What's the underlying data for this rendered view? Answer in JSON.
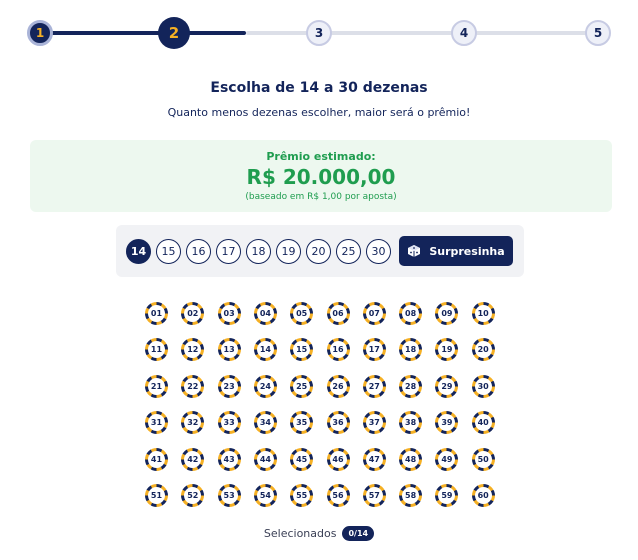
{
  "stepper": {
    "steps": [
      {
        "label": "1",
        "state": "done"
      },
      {
        "label": "2",
        "state": "current"
      },
      {
        "label": "3",
        "state": "todo"
      },
      {
        "label": "4",
        "state": "todo"
      },
      {
        "label": "5",
        "state": "todo"
      }
    ]
  },
  "header": {
    "title": "Escolha de 14 a 30 dezenas",
    "subtitle": "Quanto menos dezenas escolher, maior será o prêmio!"
  },
  "prize": {
    "label": "Prêmio estimado:",
    "value": "R$ 20.000,00",
    "note": "(baseado em R$ 1,00 por aposta)"
  },
  "picker": {
    "options": [
      "14",
      "15",
      "16",
      "17",
      "18",
      "19",
      "20",
      "25",
      "30"
    ],
    "selected": "14",
    "surprise_label": "Surpresinha",
    "surprise_icon": "dice-icon"
  },
  "numbers": [
    "01",
    "02",
    "03",
    "04",
    "05",
    "06",
    "07",
    "08",
    "09",
    "10",
    "11",
    "12",
    "13",
    "14",
    "15",
    "16",
    "17",
    "18",
    "19",
    "20",
    "21",
    "22",
    "23",
    "24",
    "25",
    "26",
    "27",
    "28",
    "29",
    "30",
    "31",
    "32",
    "33",
    "34",
    "35",
    "36",
    "37",
    "38",
    "39",
    "40",
    "41",
    "42",
    "43",
    "44",
    "45",
    "46",
    "47",
    "48",
    "49",
    "50",
    "51",
    "52",
    "53",
    "54",
    "55",
    "56",
    "57",
    "58",
    "59",
    "60"
  ],
  "selection": {
    "label": "Selecionados",
    "count": "0/14"
  },
  "colors": {
    "navy": "#13245a",
    "gold": "#f5b024",
    "green": "#1f9d4f"
  }
}
